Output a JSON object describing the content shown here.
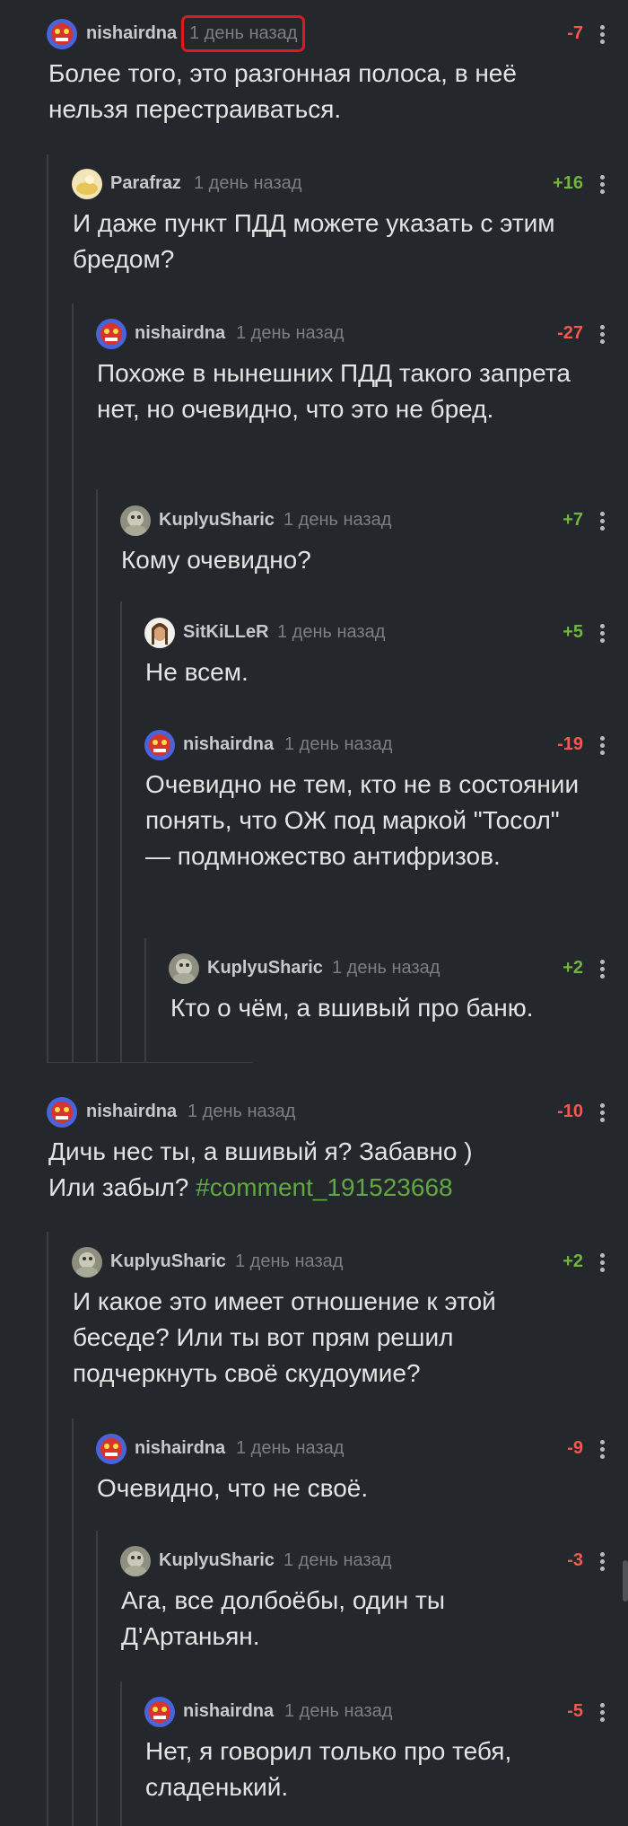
{
  "comments": [
    {
      "user": "nishairdna",
      "time": "1 день назад",
      "rating": "-7",
      "text": "Более того, это разгонная полоса, в неё нельзя перестраиваться."
    },
    {
      "user": "Parafraz",
      "time": "1 день назад",
      "rating": "+16",
      "text": "И даже пункт ПДД можете указать с этим бредом?"
    },
    {
      "user": "nishairdna",
      "time": "1 день назад",
      "rating": "-27",
      "text": "Похоже в нынешних ПДД такого запрета нет, но очевидно, что это не бред."
    },
    {
      "user": "KuplyuSharic",
      "time": "1 день назад",
      "rating": "+7",
      "text": "Кому очевидно?"
    },
    {
      "user": "SitKiLLeR",
      "time": "1 день назад",
      "rating": "+5",
      "text": "Не всем."
    },
    {
      "user": "nishairdna",
      "time": "1 день назад",
      "rating": "-19",
      "text": "Очевидно не тем, кто не в состоянии понять, что ОЖ под маркой \"Тосол\" — подмножество антифризов."
    },
    {
      "user": "KuplyuSharic",
      "time": "1 день назад",
      "rating": "+2",
      "text": "Кто о чём, а вшивый про баню."
    },
    {
      "user": "nishairdna",
      "time": "1 день назад",
      "rating": "-10",
      "text": "Дичь нес ты, а вшивый я? Забавно )\nИли забыл?",
      "link": "#comment_191523668"
    },
    {
      "user": "KuplyuSharic",
      "time": "1 день назад",
      "rating": "+2",
      "text": "И какое это имеет отношение к этой беседе? Или ты вот прям решил подчеркнуть своё скудоумие?"
    },
    {
      "user": "nishairdna",
      "time": "1 день назад",
      "rating": "-9",
      "text": "Очевидно, что не своё."
    },
    {
      "user": "KuplyuSharic",
      "time": "1 день назад",
      "rating": "-3",
      "text": "Ага, все долбоёбы, один ты Д'Артаньян."
    },
    {
      "user": "nishairdna",
      "time": "1 день назад",
      "rating": "-5",
      "text": "Нет, я говорил только про тебя, сладенький."
    }
  ]
}
